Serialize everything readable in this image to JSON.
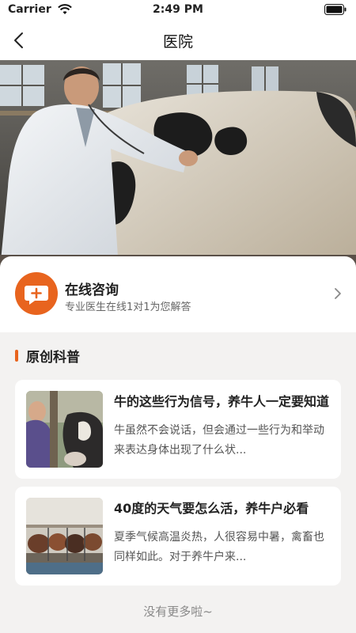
{
  "status_bar": {
    "carrier": "Carrier",
    "time": "2:49 PM"
  },
  "nav": {
    "title": "医院"
  },
  "consult": {
    "title": "在线咨询",
    "subtitle": "专业医生在线1对1为您解答"
  },
  "section": {
    "title": "原创科普"
  },
  "articles": [
    {
      "title": "牛的这些行为信号，养牛人一定要知道",
      "description": "牛虽然不会说话，但会通过一些行为和举动来表达身体出现了什么状..."
    },
    {
      "title": "40度的天气要怎么活，养牛户必看",
      "description": "夏季气候高温炎热，人很容易中暑，禽畜也同样如此。对于养牛户来..."
    }
  ],
  "footer": {
    "no_more": "没有更多啦~"
  },
  "colors": {
    "accent": "#e8641e",
    "background": "#f3f2f1",
    "card": "#ffffff"
  }
}
